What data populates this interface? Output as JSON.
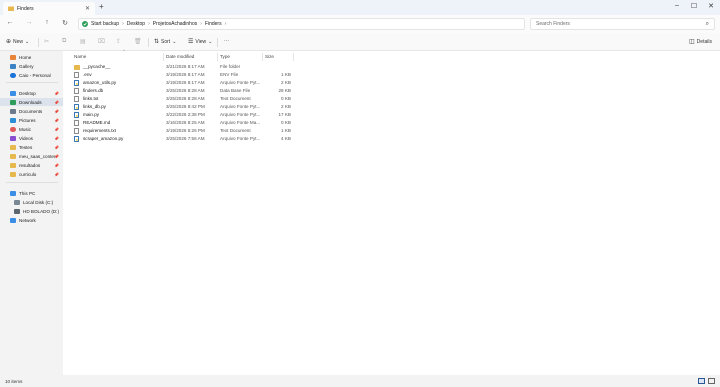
{
  "tab": {
    "title": "Finders"
  },
  "address": {
    "crumbs": [
      "Start backup",
      "Desktop",
      "ProjetosAchadinhos",
      "Finders"
    ]
  },
  "search": {
    "placeholder": "Search Finders"
  },
  "commands": {
    "new": "New",
    "sort": "Sort",
    "view": "View",
    "more": "···",
    "details": "Details"
  },
  "sidebar": {
    "items": [
      {
        "label": "Home",
        "icon": "home-icon",
        "color": "#e8833a"
      },
      {
        "label": "Gallery",
        "icon": "gallery-icon",
        "color": "#3b82c4"
      },
      {
        "label": "Caio - Personal",
        "icon": "cloud-icon",
        "color": "#1a73d9"
      },
      {
        "label": "Desktop",
        "icon": "desktop-icon",
        "color": "#3a8ee6"
      },
      {
        "label": "Downloads",
        "icon": "downloads-icon",
        "color": "#2e9c5a"
      },
      {
        "label": "Documents",
        "icon": "documents-icon",
        "color": "#6b7b8c"
      },
      {
        "label": "Pictures",
        "icon": "pictures-icon",
        "color": "#2d8fd5"
      },
      {
        "label": "Music",
        "icon": "music-icon",
        "color": "#e05a5a"
      },
      {
        "label": "Videos",
        "icon": "videos-icon",
        "color": "#8a4fd1"
      },
      {
        "label": "Testes",
        "icon": "folder-icon",
        "color": "#e7b84d"
      },
      {
        "label": "meu_saas_conter",
        "icon": "folder-icon",
        "color": "#e7b84d"
      },
      {
        "label": "resultados",
        "icon": "folder-icon",
        "color": "#e7b84d"
      },
      {
        "label": "curriculo",
        "icon": "folder-icon",
        "color": "#e7b84d"
      },
      {
        "label": "This PC",
        "icon": "pc-icon",
        "color": "#3a8ee6"
      },
      {
        "label": "Local Disk (C:)",
        "icon": "disk-icon",
        "color": "#7a8896"
      },
      {
        "label": "HD BOLADO (D:)",
        "icon": "disk-icon",
        "color": "#5c6670"
      },
      {
        "label": "Network",
        "icon": "network-icon",
        "color": "#3a8ee6"
      }
    ]
  },
  "columns": {
    "name": "Name",
    "date": "Date modified",
    "type": "Type",
    "size": "Size"
  },
  "files": [
    {
      "name": "__pycache__",
      "date": "3/21/2026 8:17 AM",
      "type": "File folder",
      "size": "",
      "kind": "folder"
    },
    {
      "name": ".env",
      "date": "3/19/2026 8:17 AM",
      "type": "ENV File",
      "size": "1 KB",
      "kind": "file"
    },
    {
      "name": "amazon_utils.py",
      "date": "3/19/2026 8:17 AM",
      "type": "Arquivo Fonte Pyt...",
      "size": "2 KB",
      "kind": "py"
    },
    {
      "name": "finders.db",
      "date": "3/25/2026 8:28 AM",
      "type": "Data Base File",
      "size": "28 KB",
      "kind": "file"
    },
    {
      "name": "links.txt",
      "date": "3/25/2026 8:28 AM",
      "type": "Text Document",
      "size": "0 KB",
      "kind": "file"
    },
    {
      "name": "links_db.py",
      "date": "3/25/2026 8:42 PM",
      "type": "Arquivo Fonte Pyt...",
      "size": "2 KB",
      "kind": "py"
    },
    {
      "name": "main.py",
      "date": "3/22/2026 2:38 PM",
      "type": "Arquivo Fonte Pyt...",
      "size": "17 KB",
      "kind": "py"
    },
    {
      "name": "README.md",
      "date": "3/16/2026 8:25 AM",
      "type": "Arquivo Fonte Ma...",
      "size": "0 KB",
      "kind": "file"
    },
    {
      "name": "requirements.txt",
      "date": "3/19/2026 5:26 PM",
      "type": "Text Document",
      "size": "1 KB",
      "kind": "file"
    },
    {
      "name": "scraper_amazon.py",
      "date": "3/25/2026 7:56 AM",
      "type": "Arquivo Fonte Pyt...",
      "size": "4 KB",
      "kind": "py"
    }
  ],
  "status": {
    "count": "10 items"
  }
}
